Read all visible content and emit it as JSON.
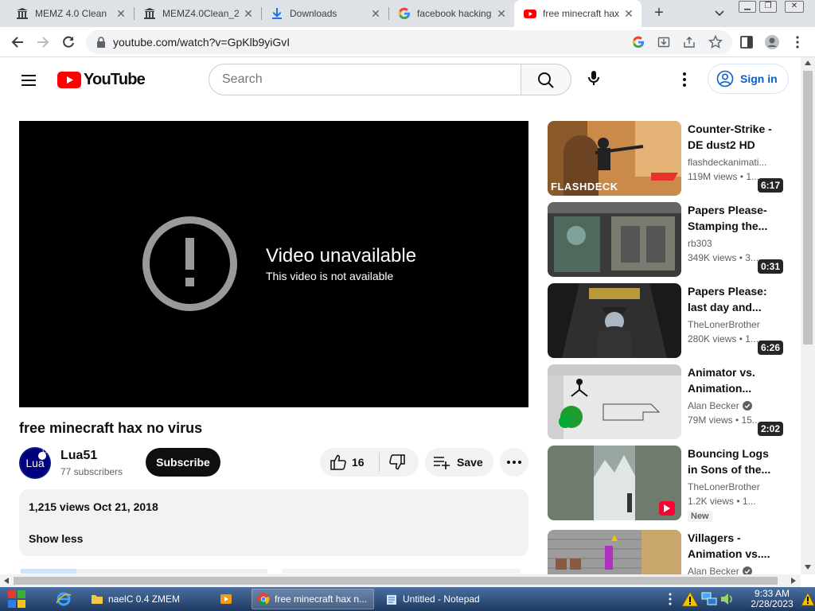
{
  "browser": {
    "tabs": [
      {
        "title": "MEMZ 4.0 Clean",
        "favicon": "museum-icon"
      },
      {
        "title": "MEMZ4.0Clean_2",
        "favicon": "museum-icon"
      },
      {
        "title": "Downloads",
        "favicon": "download-icon"
      },
      {
        "title": "facebook hacking",
        "favicon": "google-icon"
      },
      {
        "title": "free minecraft hax",
        "favicon": "youtube-icon",
        "active": true
      }
    ],
    "url": "youtube.com/watch?v=GpKlb9yiGvI"
  },
  "youtube": {
    "logo_text": "YouTube",
    "search_placeholder": "Search",
    "sign_in": "Sign in"
  },
  "player": {
    "error_title": "Video unavailable",
    "error_subtitle": "This video is not available"
  },
  "video": {
    "title": "free minecraft hax no virus",
    "channel": "Lua51",
    "avatar_text": "Lua",
    "subscribers": "77 subscribers",
    "subscribe_label": "Subscribe",
    "likes": "16",
    "save_label": "Save",
    "views": "1,215 views",
    "date": "Oct 21, 2018",
    "show_less": "Show less"
  },
  "recommendations": [
    {
      "title_line1": "Counter-Strike -",
      "title_line2": "DE dust2 HD",
      "channel": "flashdeckanimati...",
      "meta": "119M views • 1...",
      "duration": "6:17",
      "brand": "FLASHDECK",
      "verified": false
    },
    {
      "title_line1": "Papers Please-",
      "title_line2": "Stamping the...",
      "channel": "rb303",
      "meta": "349K views • 3...",
      "duration": "0:31",
      "verified": false
    },
    {
      "title_line1": "Papers Please:",
      "title_line2": "last day and...",
      "channel": "TheLonerBrother",
      "meta": "280K views • 1...",
      "duration": "6:26",
      "verified": false
    },
    {
      "title_line1": "Animator vs.",
      "title_line2": "Animation...",
      "channel": "Alan Becker",
      "meta": "79M views • 15...",
      "duration": "2:02",
      "verified": true
    },
    {
      "title_line1": "Bouncing Logs",
      "title_line2": "in Sons of the...",
      "channel": "TheLonerBrother",
      "meta": "1.2K views • 1...",
      "duration": "",
      "badge": "New",
      "verified": false
    },
    {
      "title_line1": "Villagers -",
      "title_line2": "Animation vs....",
      "channel": "Alan Becker",
      "meta": "",
      "duration": "",
      "verified": true
    }
  ],
  "taskbar": {
    "items": [
      {
        "label": "naelC 0.4 ZMEM",
        "icon": "folder-icon"
      },
      {
        "label": "",
        "icon": "media-player-icon"
      },
      {
        "label": "free minecraft hax n...",
        "icon": "chrome-icon",
        "active": true
      },
      {
        "label": "Untitled - Notepad",
        "icon": "notepad-icon"
      }
    ],
    "clock_time": "9:33 AM",
    "clock_date": "2/28/2023"
  },
  "colors": {
    "youtube_red": "#ff0000",
    "link_blue": "#065fd4",
    "taskbar": "#2c4a78"
  }
}
